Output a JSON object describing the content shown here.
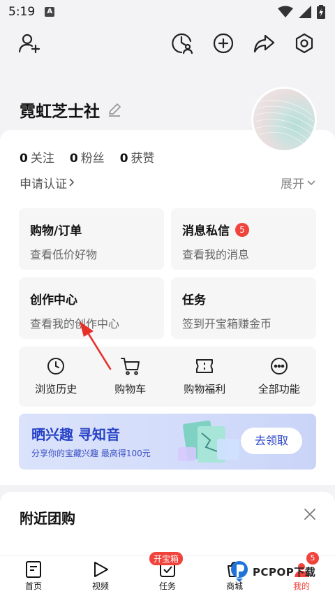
{
  "status_bar": {
    "time": "5:19",
    "notif_letter": "A"
  },
  "profile": {
    "name": "霓虹芝士社"
  },
  "stats": [
    {
      "num": "0",
      "label": "关注"
    },
    {
      "num": "0",
      "label": "粉丝"
    },
    {
      "num": "0",
      "label": "获赞"
    }
  ],
  "cert": {
    "label": "申请认证",
    "expand_label": "展开"
  },
  "tiles": {
    "orders": {
      "title": "购物/订单",
      "sub": "查看低价好物"
    },
    "messages": {
      "title": "消息私信",
      "sub": "查看我的消息",
      "badge": "5"
    },
    "creation": {
      "title": "创作中心",
      "sub": "查看我的创作中心"
    },
    "tasks": {
      "title": "任务",
      "sub": "签到开宝箱赚金币"
    }
  },
  "shortcuts": {
    "history": "浏览历史",
    "cart": "购物车",
    "benefits": "购物福利",
    "all": "全部功能"
  },
  "promo": {
    "title": "晒兴趣 寻知音",
    "sub": "分享你的宝藏兴趣 最高得100元",
    "button": "去领取"
  },
  "nearby": {
    "title": "附近团购"
  },
  "bottom_nav": {
    "home": "首页",
    "video": "视频",
    "tasks": "任务",
    "tasks_pill": "开宝箱",
    "mall": "商城",
    "me": "我的",
    "me_badge": "5"
  },
  "watermark": {
    "text": "PCPOP下载"
  },
  "colors": {
    "accent_red": "#f0433c",
    "promo_blue": "#2741c6"
  }
}
